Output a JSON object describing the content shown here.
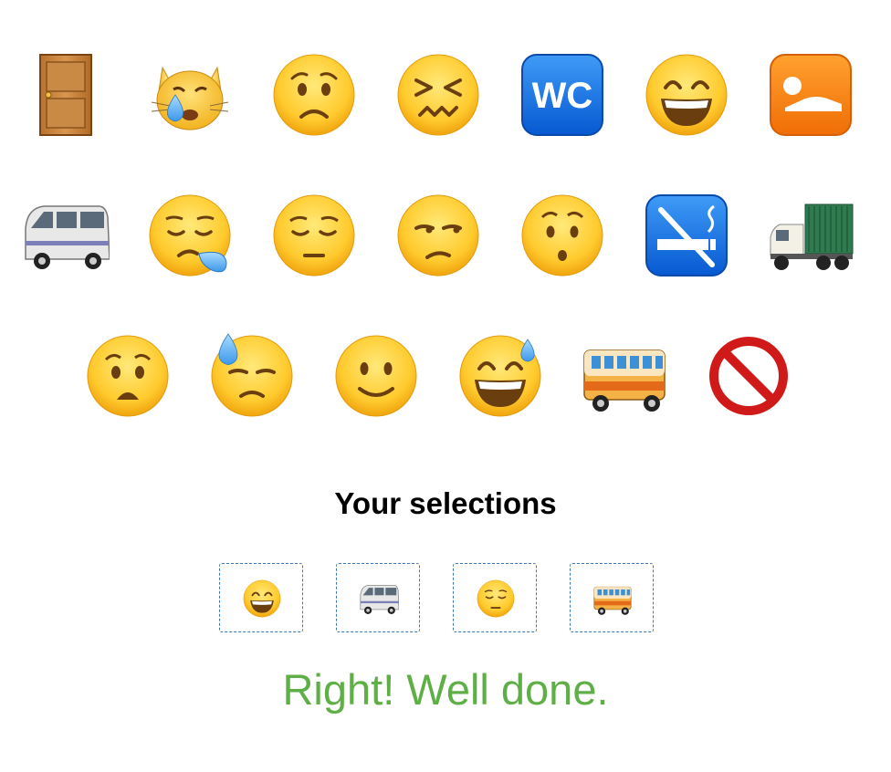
{
  "grid": {
    "rows": [
      [
        "door-icon",
        "crying-cat-face-icon",
        "worried-face-icon",
        "confounded-face-icon",
        "wc-sign-icon",
        "grinning-face-icon",
        "lying-person-icon"
      ],
      [
        "minibus-icon",
        "sleepy-face-icon",
        "pensive-face-icon",
        "unamused-face-icon",
        "hushed-face-icon",
        "no-smoking-icon",
        "delivery-truck-icon"
      ],
      [
        "anguished-face-icon",
        "cold-sweat-face-icon",
        "slightly-smiling-face-icon",
        "smiling-face-with-sweat-icon",
        "bus-icon",
        "no-entry-icon"
      ]
    ]
  },
  "wc_text": "WC",
  "selections": {
    "heading": "Your selections",
    "items": [
      "grinning-face-icon",
      "minibus-icon",
      "pensive-face-icon",
      "bus-icon"
    ]
  },
  "result": {
    "message": "Right! Well done.",
    "color": "#5faf47"
  }
}
